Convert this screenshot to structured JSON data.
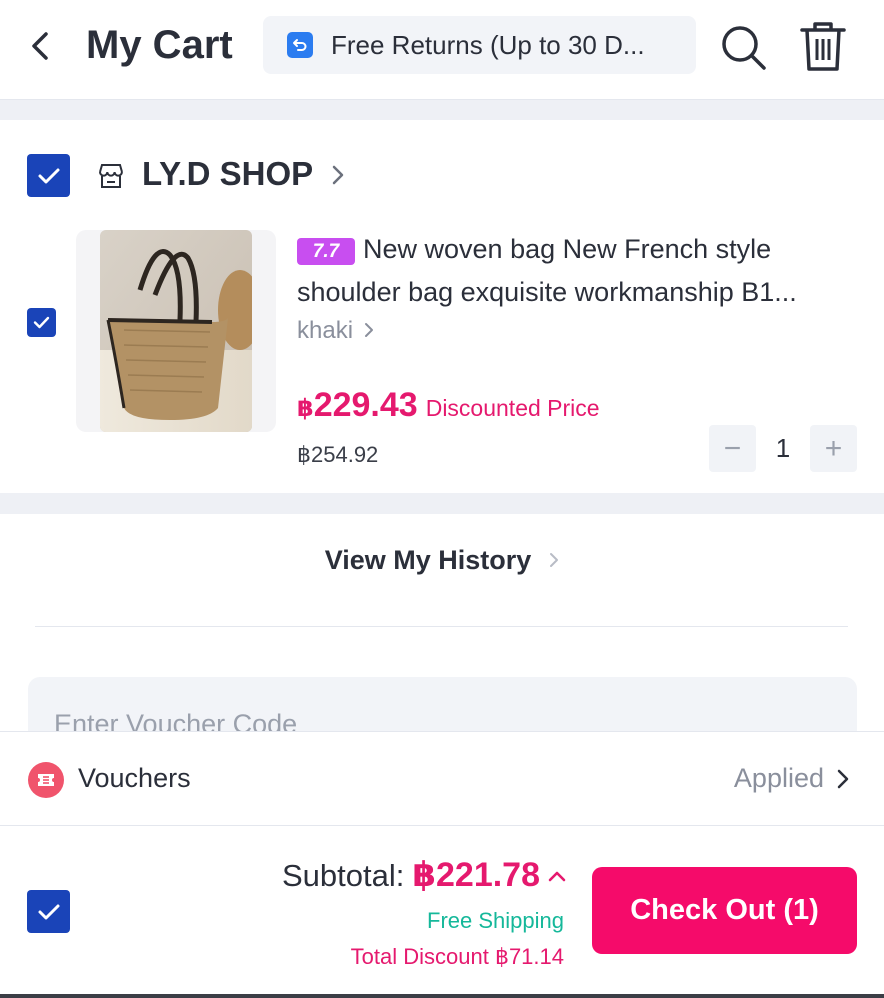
{
  "header": {
    "title": "My Cart",
    "returns_text": "Free Returns (Up to 30 D...",
    "icons": {
      "back": "back-arrow-icon",
      "returns": "return-arrow-icon",
      "search": "search-icon",
      "trash": "trash-icon"
    }
  },
  "shop": {
    "name": "LY.D SHOP",
    "selected": true,
    "icon": "store-icon",
    "item": {
      "selected": true,
      "badge": "7.7",
      "title_line1": "New woven bag New French style",
      "title_line2": "shoulder bag exquisite workmanship B1...",
      "variant": "khaki",
      "price_currency": "฿",
      "price_value": "229.43",
      "price_label": "Discounted Price",
      "original_price": "฿254.92",
      "quantity": "1",
      "minus": "−",
      "plus": "+"
    }
  },
  "history": {
    "label": "View My History"
  },
  "voucher_input": {
    "placeholder": "Enter Voucher Code"
  },
  "vouchers": {
    "label": "Vouchers",
    "status": "Applied",
    "icon": "voucher-ticket-icon"
  },
  "footer": {
    "all_selected": true,
    "subtotal_label": "Subtotal:",
    "subtotal_value": "฿221.78",
    "free_shipping": "Free Shipping",
    "total_discount": "Total Discount ฿71.14",
    "checkout_label": "Check Out (1)"
  },
  "colors": {
    "accent_pink": "#f50b6a",
    "price_pink": "#e5196e",
    "checkbox_blue": "#1a44b8",
    "free_shipping_green": "#15b89a",
    "promo_purple": "#c84ef0"
  }
}
